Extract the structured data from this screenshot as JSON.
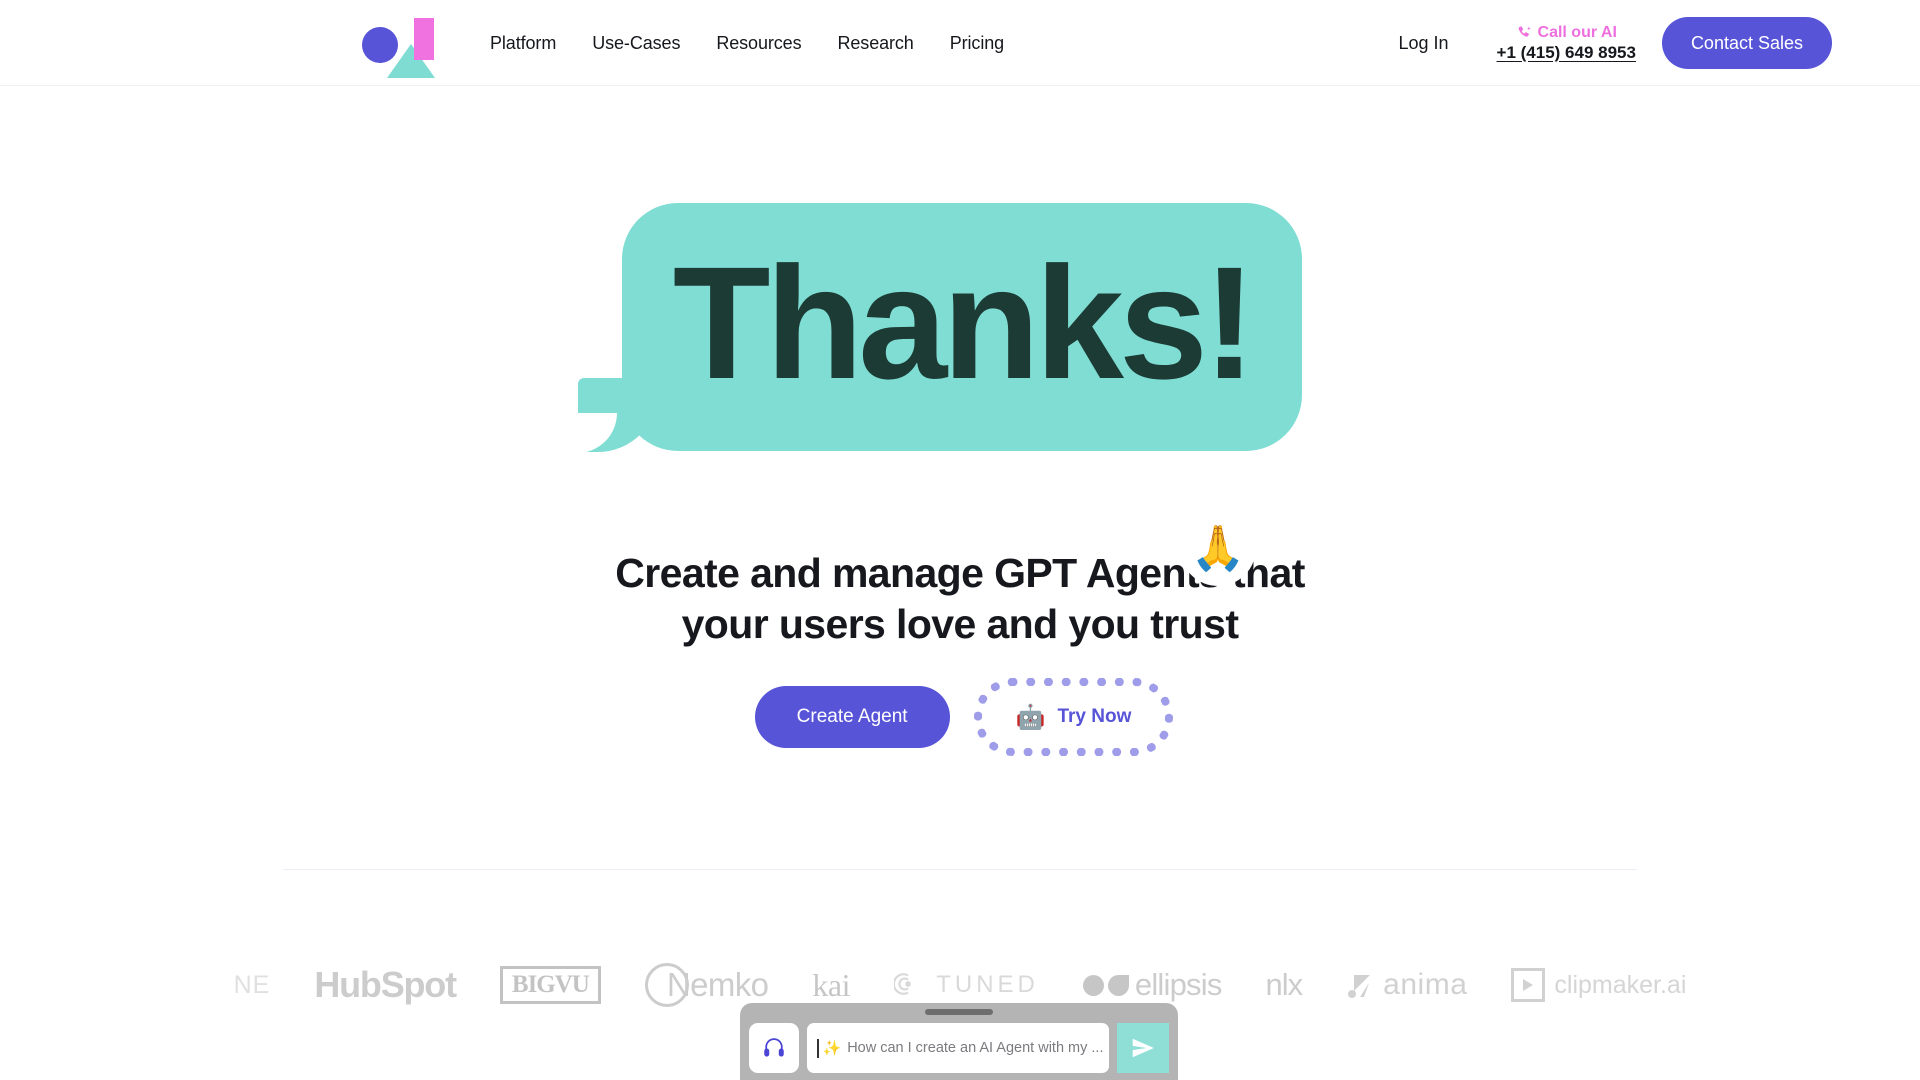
{
  "header": {
    "logo_name": "brand-logo",
    "nav": [
      {
        "label": "Platform"
      },
      {
        "label": "Use-Cases"
      },
      {
        "label": "Resources"
      },
      {
        "label": "Research"
      },
      {
        "label": "Pricing"
      }
    ],
    "login_label": "Log In",
    "call_label": "Call our AI",
    "call_number": "+1 (415) 649 8953",
    "call_icon": "phone-sparkle-icon",
    "contact_label": "Contact Sales"
  },
  "hero": {
    "bubble_text": "Thanks!",
    "bubble_emoji": "🙏",
    "bubble_emoji_name": "folded-hands-emoji",
    "headline_line1": "Create and manage GPT Agents that",
    "headline_part_bold1": "your users love",
    "headline_part_mid": " and ",
    "headline_part_bold2": "you trust",
    "cta_primary": "Create Agent",
    "cta_secondary": "Try Now",
    "cta_secondary_emoji": "🤖",
    "cta_secondary_emoji_name": "robot-emoji"
  },
  "clients": {
    "logos": [
      {
        "name": "domo",
        "label": "NE"
      },
      {
        "name": "hubspot",
        "label": "HubSpot"
      },
      {
        "name": "bigvu",
        "label": "BIGVU"
      },
      {
        "name": "nemko",
        "label": "Nemko"
      },
      {
        "name": "kai",
        "label": "kai"
      },
      {
        "name": "tuned",
        "label": "TUNED"
      },
      {
        "name": "ellipsis",
        "label": "ellipsis"
      },
      {
        "name": "nlx",
        "label": "nlx"
      },
      {
        "name": "anima",
        "label": "anima"
      },
      {
        "name": "clipmaker",
        "label": "clipmaker.ai"
      }
    ]
  },
  "chat": {
    "headset_icon": "headphones-icon",
    "sparkle_icon": "sparkles-icon",
    "placeholder": "How can I create an AI Agent with my ...",
    "send_icon": "send-arrow-icon"
  },
  "colors": {
    "brand_purple": "#5754d8",
    "brand_mint": "#7fddd4",
    "brand_pink": "#ef72e0",
    "bubble_text": "#1d3b35",
    "chat_send": "#8fdfd7",
    "chat_bar": "#b4b4b4"
  }
}
